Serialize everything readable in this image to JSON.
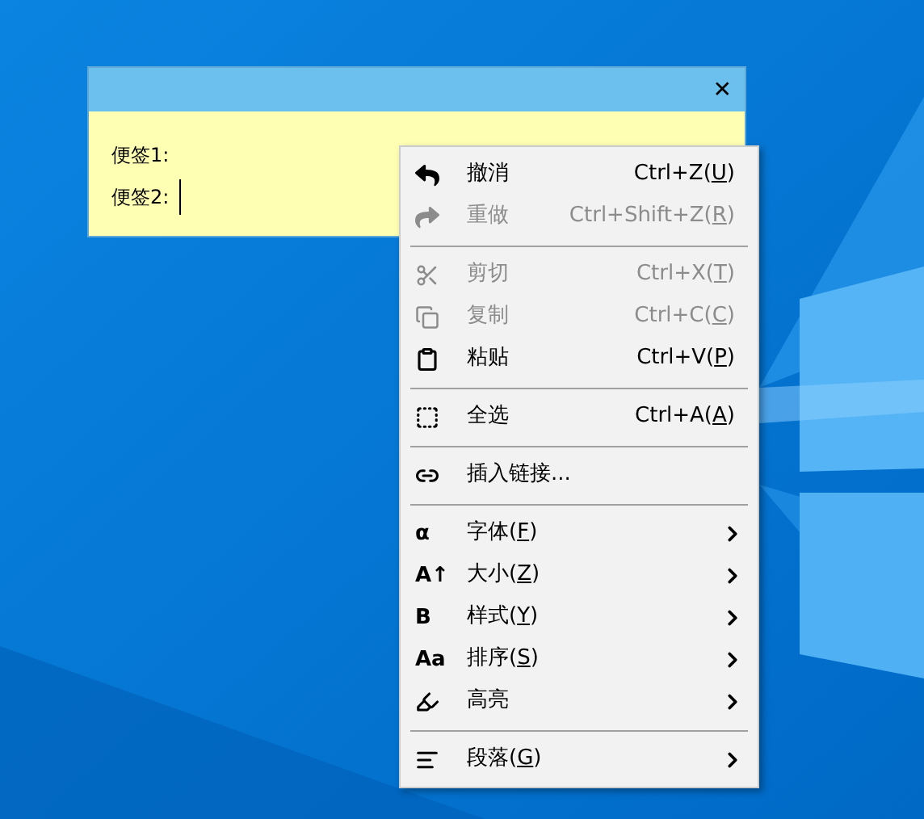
{
  "note_window": {
    "close": "✕",
    "lines": [
      {
        "label": "便签1:",
        "caret": false
      },
      {
        "label": "便签2:",
        "caret": true
      }
    ]
  },
  "context_menu": {
    "items": [
      {
        "kind": "item",
        "label": "撤消",
        "shortcut": "Ctrl+Z(",
        "key": "U",
        "end": ")",
        "disabled": false,
        "submenu": false
      },
      {
        "kind": "item",
        "label": "重做",
        "shortcut": "Ctrl+Shift+Z(",
        "key": "R",
        "end": ")",
        "disabled": true,
        "submenu": false
      },
      {
        "kind": "separator"
      },
      {
        "kind": "item",
        "label": "剪切",
        "shortcut": "Ctrl+X(",
        "key": "T",
        "end": ")",
        "disabled": true,
        "submenu": false
      },
      {
        "kind": "item",
        "label": "复制",
        "shortcut": "Ctrl+C(",
        "key": "C",
        "end": ")",
        "disabled": true,
        "submenu": false
      },
      {
        "kind": "item",
        "label": "粘贴",
        "shortcut": "Ctrl+V(",
        "key": "P",
        "end": ")",
        "disabled": false,
        "submenu": false
      },
      {
        "kind": "separator"
      },
      {
        "kind": "item",
        "label": "全选",
        "shortcut": "Ctrl+A(",
        "key": "A",
        "end": ")",
        "disabled": false,
        "submenu": false
      },
      {
        "kind": "separator"
      },
      {
        "kind": "item",
        "label": "插入链接...",
        "disabled": false,
        "submenu": false
      },
      {
        "kind": "separator"
      },
      {
        "kind": "item",
        "glyph": "α",
        "label": "字体(",
        "label_key": "F",
        "label_end": ")",
        "disabled": false,
        "submenu": true
      },
      {
        "kind": "item",
        "glyph": "A↑",
        "label": "大小(",
        "label_key": "Z",
        "label_end": ")",
        "disabled": false,
        "submenu": true
      },
      {
        "kind": "item",
        "glyph": "B",
        "label": "样式(",
        "label_key": "Y",
        "label_end": ")",
        "disabled": false,
        "submenu": true
      },
      {
        "kind": "item",
        "glyph": "Aa",
        "label": "排序(",
        "label_key": "S",
        "label_end": ")",
        "disabled": false,
        "submenu": true
      },
      {
        "kind": "item",
        "label": "高亮",
        "disabled": false,
        "submenu": true
      },
      {
        "kind": "separator"
      },
      {
        "kind": "item",
        "label": "段落(",
        "label_key": "G",
        "label_end": ")",
        "disabled": false,
        "submenu": true
      }
    ]
  }
}
